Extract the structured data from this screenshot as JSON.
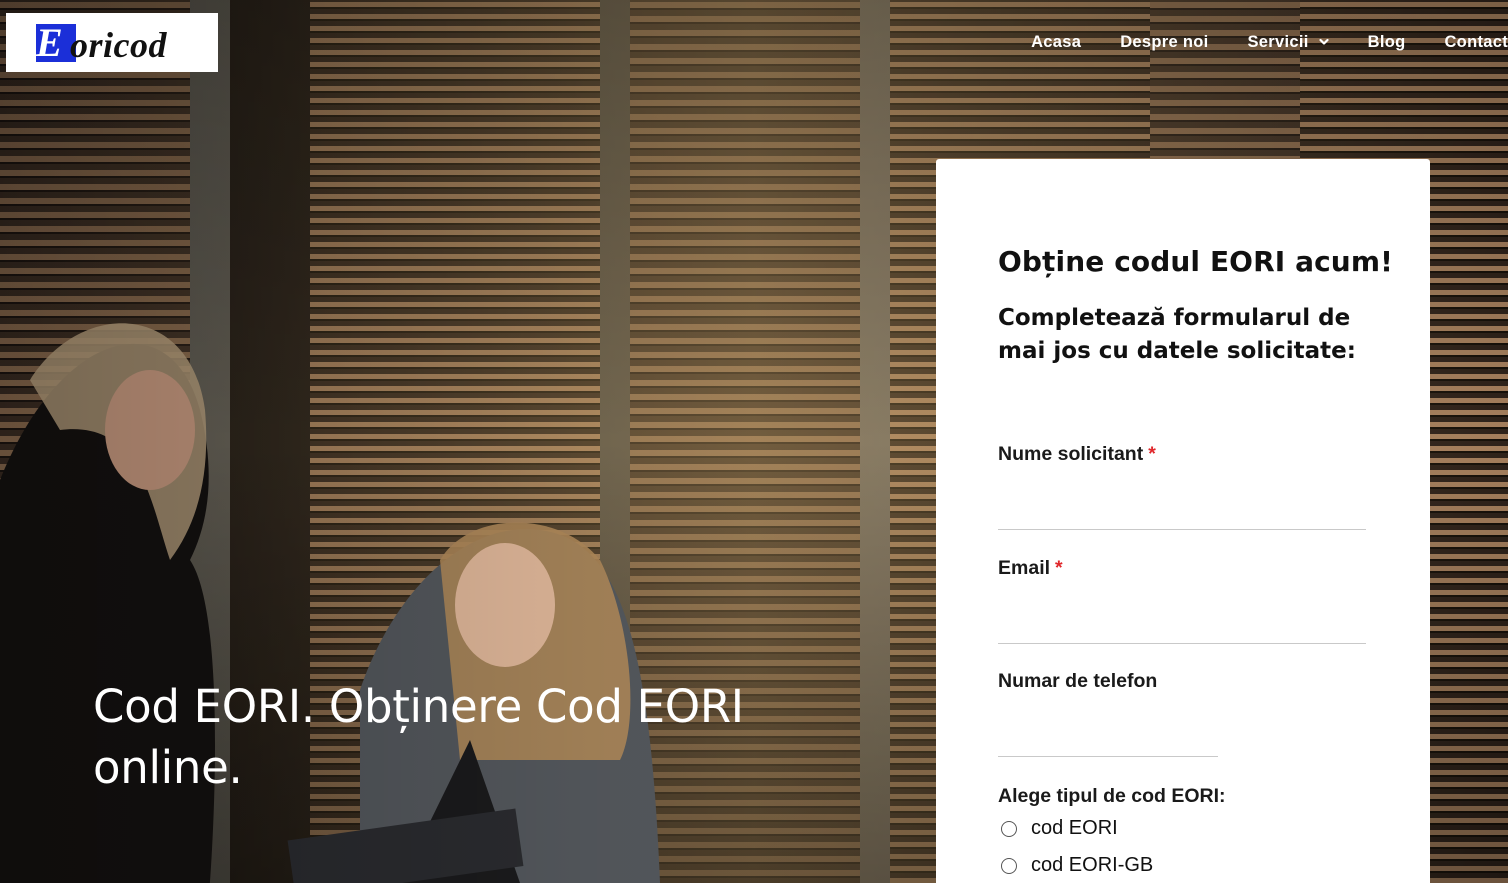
{
  "brand": {
    "logo_letter": "E",
    "logo_rest": "oricod"
  },
  "nav": {
    "items": [
      {
        "label": "Acasa"
      },
      {
        "label": "Despre noi"
      },
      {
        "label": "Servicii",
        "has_dropdown": true
      },
      {
        "label": "Blog"
      },
      {
        "label": "Contact"
      }
    ]
  },
  "hero": {
    "title": "Cod EORI. Obținere Cod EORI online."
  },
  "form": {
    "title": "Obține codul EORI acum!",
    "subtitle": "Completează formularul de mai jos cu datele solicitate:",
    "fields": {
      "name": {
        "label": "Nume solicitant",
        "required_mark": "*",
        "value": "",
        "placeholder": ""
      },
      "email": {
        "label": "Email",
        "required_mark": "*",
        "value": "",
        "placeholder": ""
      },
      "phone": {
        "label": "Numar de telefon",
        "value": "",
        "placeholder": ""
      }
    },
    "eori_type": {
      "label": "Alege tipul de cod EORI:",
      "options": [
        {
          "label": "cod EORI",
          "selected": false
        },
        {
          "label": "cod EORI-GB",
          "selected": false
        }
      ]
    }
  },
  "colors": {
    "logo_blue": "#1b2fd8",
    "required_red": "#e0262a",
    "card_bg": "#ffffff"
  }
}
